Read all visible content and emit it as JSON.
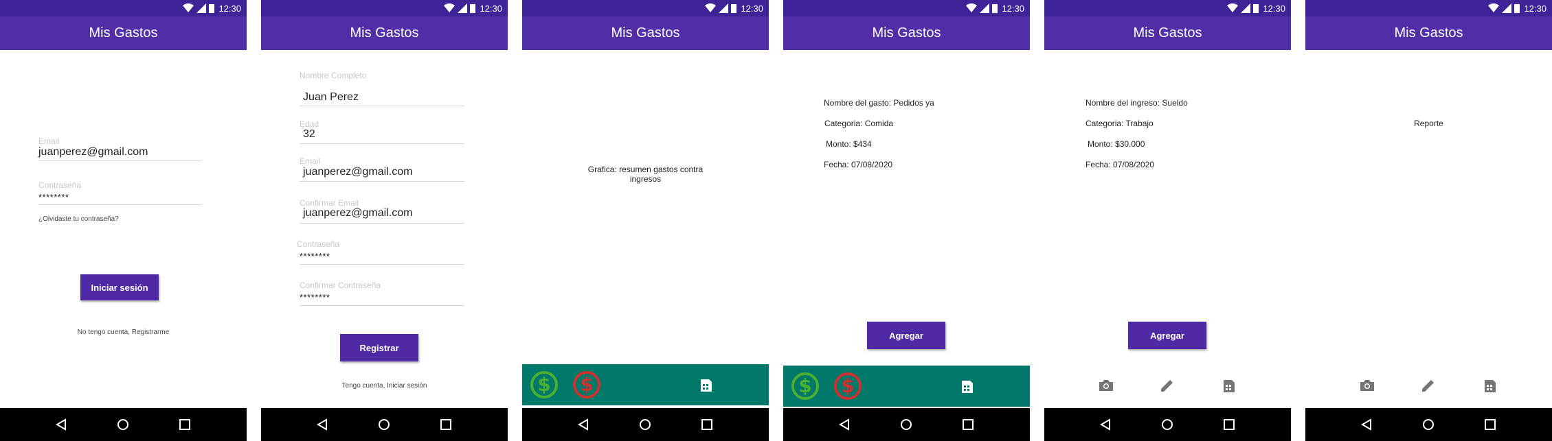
{
  "status": {
    "time": "12:30"
  },
  "app": {
    "title": "Mis Gastos"
  },
  "login": {
    "email_label": "Email",
    "email_value": "juanperez@gmail.com",
    "password_label": "Contraseña",
    "password_value": "********",
    "forgot": "¿Olvidaste tu contraseña?",
    "login_button": "Iniciar sesión",
    "register_link": "No tengo cuenta, Registrarme"
  },
  "register": {
    "name_label": "Nombre Completo",
    "name_value": "Juan Perez",
    "age_label": "Edad",
    "age_value": "32",
    "email_label": "Email",
    "email_value": "juanperez@gmail.com",
    "confirm_email_label": "Confirmar Email",
    "confirm_email_value": "juanperez@gmail.com",
    "password_label": "Contraseña",
    "password_value": "********",
    "confirm_password_label": "Confirmar Contraseña",
    "confirm_password_value": "********",
    "register_button": "Registrar",
    "login_link": "Tengo cuenta, Iniciar sesión"
  },
  "chart_screen": {
    "placeholder_line1": "Grafica: resumen gastos contra",
    "placeholder_line2": "ingresos"
  },
  "expense": {
    "name": "Nombre del gasto: Pedidos ya",
    "category": "Categoria: Comida",
    "amount": "Monto: $434",
    "date": "Fecha: 07/08/2020",
    "add_button": "Agregar"
  },
  "income": {
    "name": "Nombre del ingreso: Sueldo",
    "category": "Categoria: Trabajo",
    "amount": "Monto: $30.000",
    "date": "Fecha: 07/08/2020",
    "add_button": "Agregar"
  },
  "report": {
    "title": "Reporte"
  },
  "icons": {
    "income": "dollar-green-icon",
    "expense": "dollar-red-icon",
    "report": "report-icon",
    "camera": "camera-icon",
    "edit": "pencil-icon",
    "back": "back-icon",
    "home": "home-icon",
    "recents": "recents-icon"
  },
  "colors": {
    "status_bar": "#3f2498",
    "app_bar": "#512da8",
    "button": "#4f2aa4",
    "bottom_bar": "#00796b",
    "income_green": "#4caf2f",
    "expense_red": "#d32f2f"
  }
}
